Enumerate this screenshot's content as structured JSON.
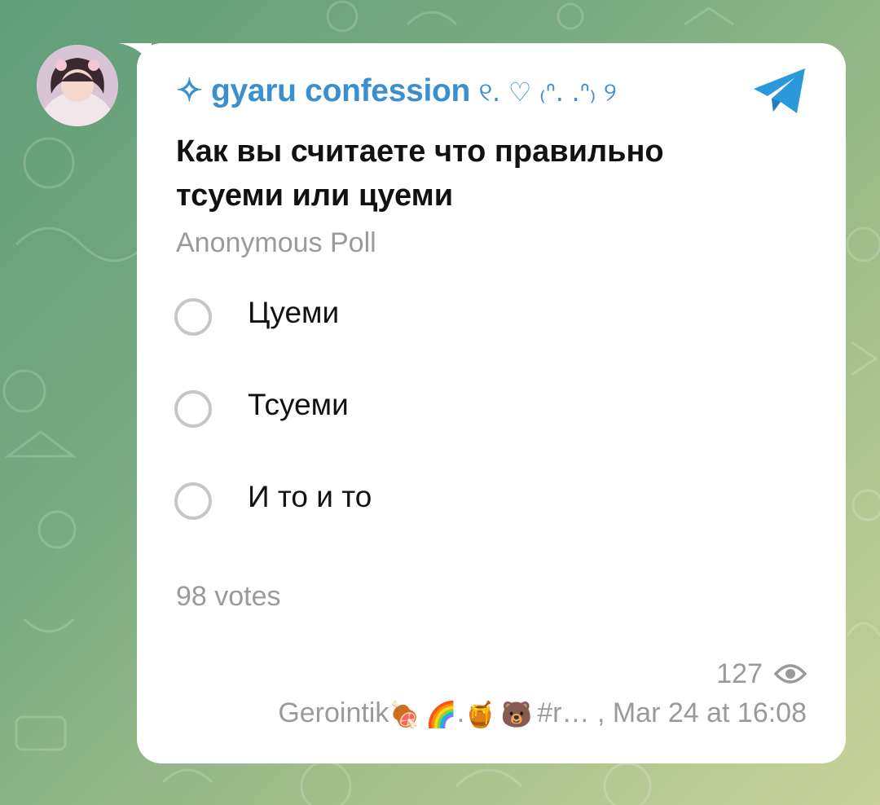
{
  "post": {
    "channel_name": "gyaru confession",
    "channel_prefix": "✧",
    "channel_suffix": "୧. ♡ ₍ᐢ. .ᐢ₎ ୨",
    "question": "Как вы считаете что правильно тсуеми или цуеми",
    "poll_type": "Anonymous Poll",
    "options": [
      {
        "label": "Цуеми"
      },
      {
        "label": "Тсуеми"
      },
      {
        "label": "И то и то"
      }
    ],
    "votes": "98 votes",
    "views": "127",
    "author": "Gerointik",
    "author_emojis": [
      "🍖",
      "🌈",
      ".",
      "🍯",
      "🐻"
    ],
    "author_tail": "#r… ,",
    "timestamp": "Mar 24 at 16:08"
  },
  "colors": {
    "accent": "#3a8fd0",
    "telegram": "#2b98db",
    "muted": "#9a9a9a",
    "radio": "#c6c6c6"
  },
  "icons": {
    "telegram": "telegram-plane-icon",
    "views": "eye-icon",
    "avatar": "channel-avatar"
  }
}
